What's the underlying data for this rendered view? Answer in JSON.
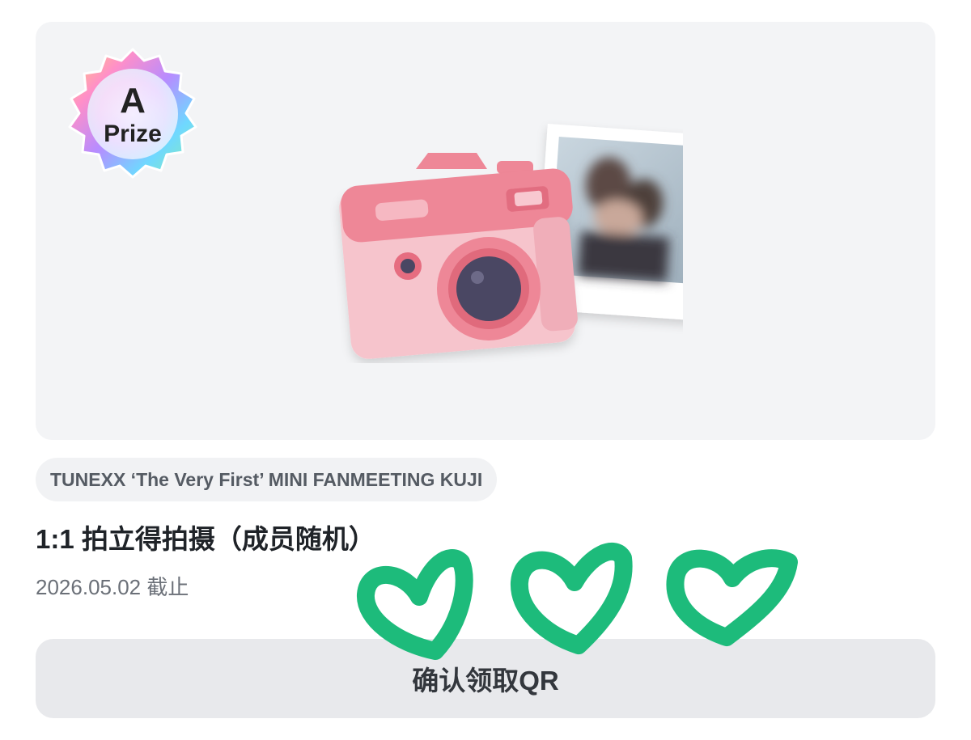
{
  "prize_card": {
    "badge": {
      "letter": "A",
      "word": "Prize"
    },
    "image_description_icon": "camera-with-polaroid-icon"
  },
  "event": {
    "name": "TUNEXX ‘The Very First’ MINI FANMEETING KUJI"
  },
  "prize": {
    "title": "1:1 拍立得拍摄（成员随机）",
    "deadline": "2026.05.02 截止"
  },
  "actions": {
    "confirm_label": "确认领取QR"
  },
  "colors": {
    "hero_bg": "#f3f4f6",
    "heart_green": "#1dbb7b",
    "camera_pink": "#f08a9a",
    "camera_body": "#f6c3cc",
    "lens_dark": "#4a4763"
  },
  "overlay": {
    "icon": "green-hand-drawn-hearts-icon",
    "count": 3
  }
}
